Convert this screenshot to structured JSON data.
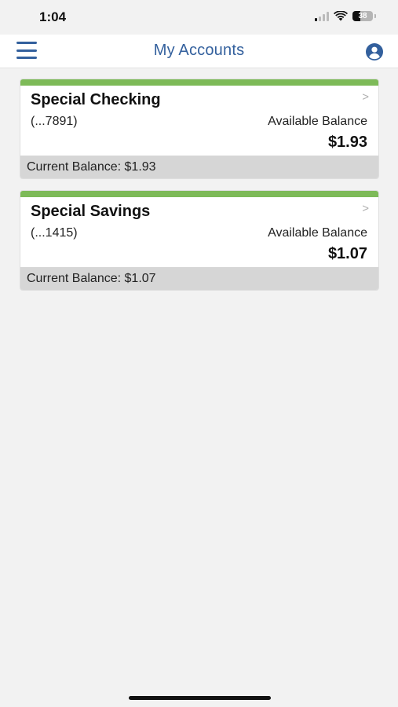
{
  "status_bar": {
    "time": "1:04",
    "battery_level": "38",
    "icons": [
      "signal-icon",
      "wifi-icon",
      "battery-icon"
    ]
  },
  "header": {
    "title": "My Accounts",
    "menu_icon": "menu-icon",
    "profile_icon": "user-profile-icon"
  },
  "accounts": [
    {
      "name": "Special Checking",
      "number": "(...7891)",
      "available_label": "Available Balance",
      "available_balance": "$1.93",
      "current_label": "Current Balance:",
      "current_balance": "$1.93"
    },
    {
      "name": "Special Savings",
      "number": "(...1415)",
      "available_label": "Available Balance",
      "available_balance": "$1.07",
      "current_label": "Current Balance:",
      "current_balance": "$1.07"
    }
  ],
  "colors": {
    "brand": "#33609d",
    "accent": "#7dba58",
    "footer": "#d6d6d6",
    "background": "#f2f2f2"
  }
}
